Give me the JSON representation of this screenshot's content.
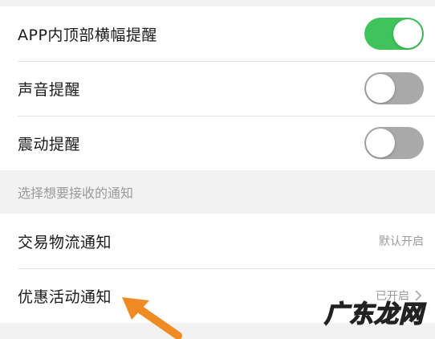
{
  "toggles": [
    {
      "label": "APP内顶部横幅提醒",
      "on": true
    },
    {
      "label": "声音提醒",
      "on": false
    },
    {
      "label": "震动提醒",
      "on": false
    }
  ],
  "section_header": "选择想要接收的通知",
  "notifications": [
    {
      "label": "交易物流通知",
      "value": "默认开启",
      "chevron": false
    },
    {
      "label": "优惠活动通知",
      "value": "已开启",
      "chevron": true
    }
  ],
  "colors": {
    "toggle_on": "#3fc35a",
    "toggle_off": "#a9a9a9",
    "arrow": "#f08a24"
  },
  "watermark": "广东龙网",
  "icons": {
    "chevron": "chevron-right-icon",
    "arrow": "pointer-arrow-icon"
  }
}
